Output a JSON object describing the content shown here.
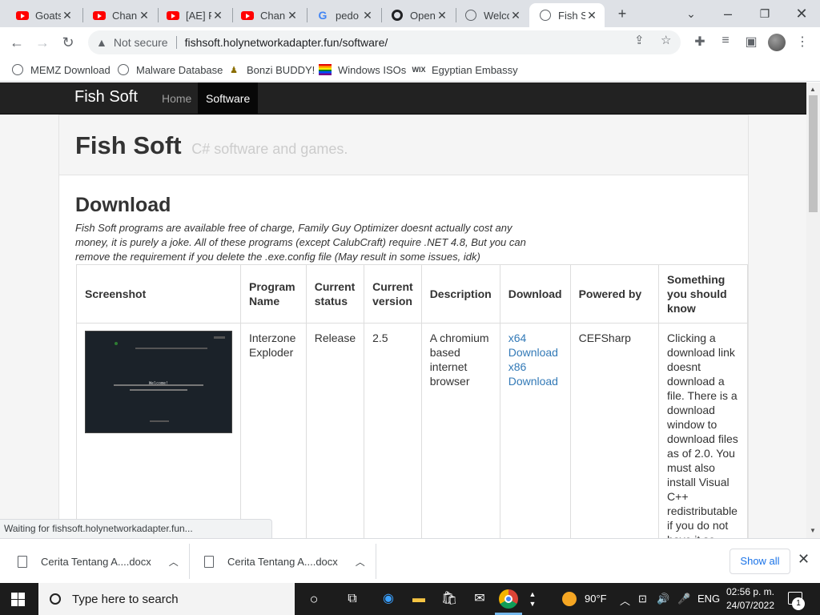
{
  "browser": {
    "tabs": [
      {
        "title": "Goats",
        "icon": "youtube-icon"
      },
      {
        "title": "Chann",
        "icon": "youtube-icon"
      },
      {
        "title": "[AE] F",
        "icon": "youtube-icon"
      },
      {
        "title": "Chann",
        "icon": "youtube-icon"
      },
      {
        "title": "pedo",
        "icon": "google-icon"
      },
      {
        "title": "Open",
        "icon": "openai-icon"
      },
      {
        "title": "Welco",
        "icon": "globe-icon"
      },
      {
        "title": "Fish S",
        "icon": "globe-icon",
        "active": true
      }
    ],
    "new_tab_symbol": "+",
    "address": {
      "security_label": "Not secure",
      "url": "fishsoft.holynetworkadapter.fun/software/"
    },
    "bookmarks": [
      {
        "label": "MEMZ Download",
        "icon": "globe-icon"
      },
      {
        "label": "Malware Database",
        "icon": "globe-icon"
      },
      {
        "label": "Bonzi BUDDY!",
        "icon": "bonzi-icon"
      },
      {
        "label": "Windows ISOs",
        "icon": "rainbow-flag-icon"
      },
      {
        "label": "Egyptian Embassy",
        "icon": "wix-icon",
        "icon_text": "WIX"
      }
    ],
    "status_text": "Waiting for fishsoft.holynetworkadapter.fun..."
  },
  "site": {
    "brand": "Fish Soft",
    "nav": [
      {
        "label": "Home",
        "active": false
      },
      {
        "label": "Software",
        "active": true
      }
    ],
    "header": {
      "title": "Fish Soft",
      "subtitle": "C# software and games."
    },
    "download": {
      "title": "Download",
      "description": "Fish Soft programs are available free of charge, Family Guy Optimizer doesnt actually cost any money, it is purely a joke. All of these programs (except CalubCraft) require .NET 4.8, But you can remove the requirement if you delete the .exe.config file (May result in some issues, idk)"
    },
    "table": {
      "headers": [
        "Screenshot",
        "Program Name",
        "Current status",
        "Current version",
        "Description",
        "Download",
        "Powered by",
        "Something you should know"
      ],
      "rows": [
        {
          "screenshot_text": "Welcome!",
          "program_name": "Interzone Exploder",
          "status": "Release",
          "version": "2.5",
          "description": "A chromium based internet browser",
          "download_links": [
            "x64 Download",
            "x86 Download"
          ],
          "powered_by": "CEFSharp",
          "note": "Clicking a download link doesnt download a file. There is a download window to download files as of 2.0. You must also install Visual C++ redistributable if you do not have it so..."
        }
      ]
    }
  },
  "downloads_shelf": {
    "items": [
      "Cerita Tentang A....docx",
      "Cerita Tentang A....docx"
    ],
    "show_all": "Show all"
  },
  "taskbar": {
    "search_placeholder": "Type here to search",
    "weather": "90°F",
    "language": "ENG",
    "time": "02:56 p. m.",
    "date": "24/07/2022",
    "notification_count": "1"
  }
}
